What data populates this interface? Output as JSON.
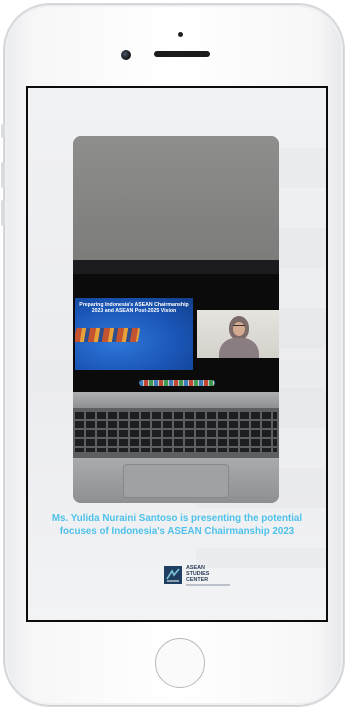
{
  "device": {
    "type": "smartphone",
    "color": "#ffffff"
  },
  "post": {
    "photo": {
      "slide_title": "Preparing Indonesia's ASEAN Chairmanship 2023 and ASEAN Post-2025 Vision",
      "description": "laptop showing presentation slide and speaker video call"
    },
    "caption": "Ms. Yulida Nuraini Santoso is presenting  the potential focuses of Indonesia's ASEAN Chairmanship 2023",
    "caption_color": "#4dc1ea",
    "logo": {
      "line1": "ASEAN",
      "line2": "STUDIES",
      "line3": "CENTER",
      "icon": "asc-logo-icon"
    }
  }
}
